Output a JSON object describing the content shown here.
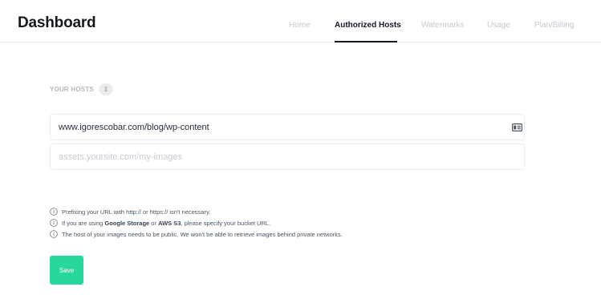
{
  "header": {
    "title": "Dashboard",
    "tabs": [
      {
        "label": "Home",
        "active": false
      },
      {
        "label": "Authorized Hosts",
        "active": true
      },
      {
        "label": "Watermarks",
        "active": false
      },
      {
        "label": "Usage",
        "active": false
      },
      {
        "label": "Plan/Billing",
        "active": false
      }
    ]
  },
  "hosts": {
    "section_label": "YOUR HOSTS",
    "count": "1",
    "items": [
      {
        "value": "www.igorescobar.com/blog/wp-content",
        "icon": "id-card-icon"
      }
    ],
    "new_host": {
      "value": "",
      "placeholder": "assets.yoursite.com/my-images"
    }
  },
  "notes": {
    "n1": {
      "text": "Prefixing your URL with http:// or https:// isn't necessary."
    },
    "n2": {
      "pre": "If you are using ",
      "b1": "Google Storage",
      "mid": " or ",
      "b2": "AWS S3",
      "post": ", please specify your bucket URL."
    },
    "n3": {
      "text": "The host of your images needs to be public. We won't be able to retrieve images behind private networks."
    }
  },
  "actions": {
    "save_label": "Save"
  },
  "colors": {
    "accent": "#27d89a",
    "text": "#1f2937",
    "muted": "#c4c8cf",
    "border": "#ececec"
  }
}
